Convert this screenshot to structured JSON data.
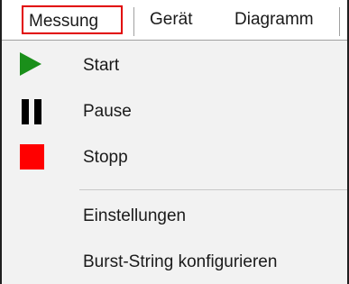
{
  "menubar": {
    "items": [
      {
        "label": "Messung"
      },
      {
        "label": "Gerät"
      },
      {
        "label": "Diagramm"
      }
    ]
  },
  "dropdown": {
    "items": [
      {
        "label": "Start",
        "icon": "play-icon"
      },
      {
        "label": "Pause",
        "icon": "pause-icon"
      },
      {
        "label": "Stopp",
        "icon": "stop-icon"
      },
      {
        "label": "Einstellungen"
      },
      {
        "label": "Burst-String konfigurieren"
      }
    ]
  },
  "colors": {
    "highlight_border": "#e10000",
    "play": "#1a8f1a",
    "stop": "#ff0000",
    "pause": "#000000",
    "menu_background": "#f2f2f2"
  }
}
